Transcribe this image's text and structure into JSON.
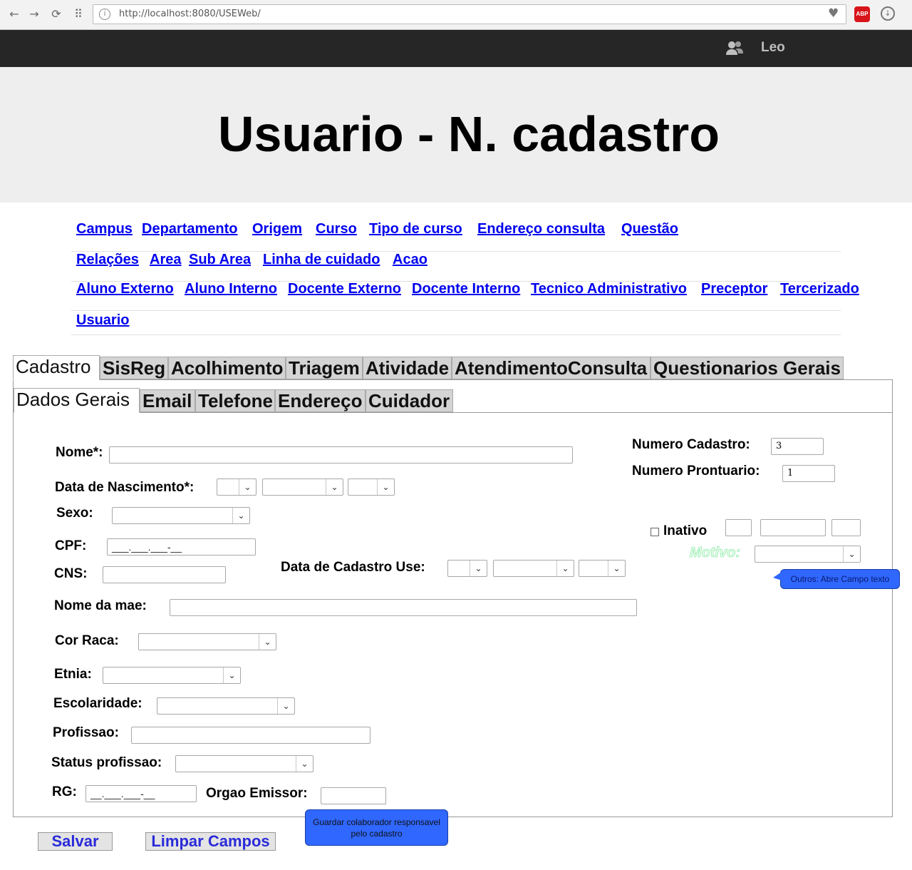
{
  "browser": {
    "url": "http://localhost:8080/USEWeb/",
    "back": "←",
    "forward": "→",
    "reload": "⟳",
    "apps": "⠿",
    "abp_label": "ABP",
    "icons": [
      "back-icon",
      "forward-icon",
      "reload-icon",
      "apps-icon",
      "info-icon",
      "heart-icon",
      "adblock-icon",
      "download-icon"
    ]
  },
  "header": {
    "user_name": "Leo",
    "user_icon": "users-icon",
    "title": "Usuario - N. cadastro"
  },
  "nav": {
    "rows": [
      [
        "Campus",
        "Departamento",
        "Origem",
        "Curso",
        "Tipo de curso",
        "Endereço consulta",
        "Questão"
      ],
      [
        "Relações",
        "Area",
        "Sub Area",
        "Linha de cuidado",
        "Acao"
      ],
      [
        "Aluno Externo",
        "Aluno Interno",
        "Docente Externo",
        "Docente Interno",
        "Tecnico Administrativo",
        "Preceptor",
        "Tercerizado"
      ],
      [
        "Usuario"
      ]
    ]
  },
  "tabs": {
    "main": [
      "Cadastro",
      "SisReg",
      "Acolhimento",
      "Triagem",
      "Atividade",
      "AtendimentoConsulta",
      "Questionarios Gerais"
    ],
    "active_main": "Cadastro",
    "sub": [
      "Dados Gerais",
      "Email",
      "Telefone",
      "Endereço",
      "Cuidador"
    ],
    "active_sub": "Dados Gerais"
  },
  "form": {
    "nome_label": "Nome*:",
    "nome_value": "",
    "nascimento_label": "Data de Nascimento*:",
    "sexo_label": "Sexo:",
    "cpf_label": "CPF:",
    "cpf_mask": "___.___.___-__",
    "cns_label": "CNS:",
    "data_cadastro_label": "Data de Cadastro Use:",
    "nome_mae_label": "Nome da mae:",
    "cor_raca_label": "Cor Raca:",
    "etnia_label": "Etnia:",
    "escolaridade_label": "Escolaridade:",
    "profissao_label": "Profissao:",
    "status_profissao_label": "Status profissao:",
    "rg_label": "RG:",
    "rg_mask": "__.___.___-__",
    "orgao_emissor_label": "Orgao Emissor:",
    "numero_cadastro_label": "Numero Cadastro:",
    "numero_cadastro_value": "3",
    "numero_prontuario_label": "Numero Prontuario:",
    "numero_prontuario_value": "1",
    "inativo_label": "Inativo",
    "motivo_label": "Motivo:"
  },
  "callouts": {
    "motivo_note": "Outros: Abre Campo texto",
    "save_note": "Guardar colaborador responsavel pelo cadastro"
  },
  "actions": {
    "save": "Salvar",
    "clear": "Limpar Campos"
  },
  "colors": {
    "link": "#0000ee",
    "topbar": "#262626",
    "hero_bg": "#eeeeee",
    "callout": "#2f67ff"
  }
}
